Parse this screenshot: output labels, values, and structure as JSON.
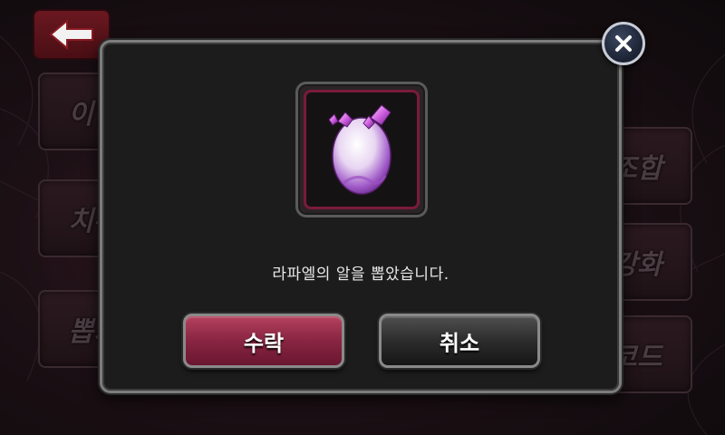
{
  "background": {
    "left_buttons": [
      "이언",
      "치유",
      "뽑기"
    ],
    "right_buttons": [
      "조합",
      "강화",
      "코드"
    ]
  },
  "dialog": {
    "item_icon": "purple-crystal-egg",
    "message": "라파엘의 알을 뽑았습니다.",
    "accept_label": "수락",
    "cancel_label": "취소",
    "close_icon": "close-x-icon"
  },
  "colors": {
    "accept_button": "#8c2744",
    "cancel_button": "#2c2c2c",
    "item_frame_border": "#7a1a3c",
    "close_button": "#1b2232"
  }
}
